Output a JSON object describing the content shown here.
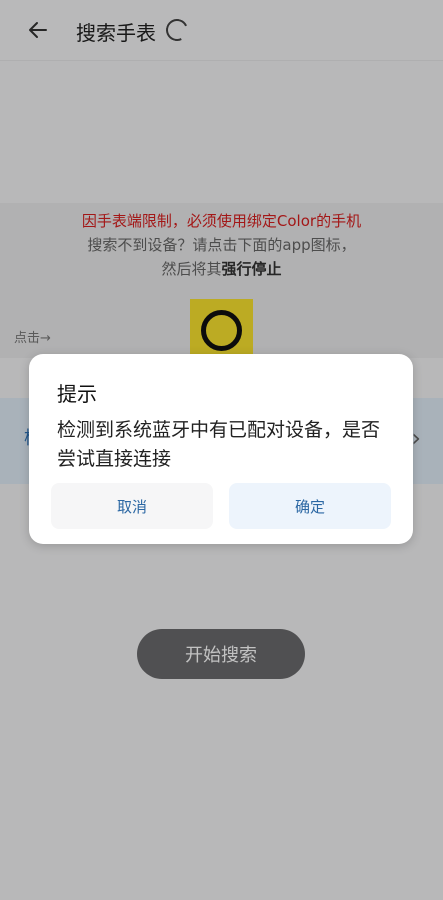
{
  "header": {
    "title": "搜索手表"
  },
  "info": {
    "line1": "因手表端限制，必须使用绑定Color的手机",
    "line2": "搜索不到设备？请点击下面的app图标，",
    "line3_prefix": "然后将其",
    "line3_bold": "强行停止"
  },
  "tap_hint": "点击→",
  "device_row": {
    "left_fragment": "杨"
  },
  "start_button": {
    "label": "开始搜索"
  },
  "dialog": {
    "title": "提示",
    "message": "检测到系统蓝牙中有已配对设备，是否尝试直接连接",
    "cancel_label": "取消",
    "confirm_label": "确定"
  },
  "colors": {
    "accent": "#2b67a3",
    "warning": "#d71f1f",
    "app_icon_bg": "#f7e12f"
  },
  "icons": {
    "back": "arrow-left-icon",
    "loading": "spinner-icon",
    "chevron": "chevron-right-icon",
    "app": "ring-app-icon"
  }
}
